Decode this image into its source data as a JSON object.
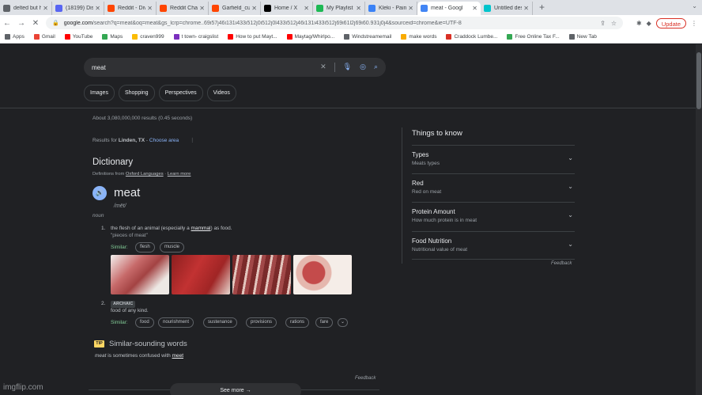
{
  "browser": {
    "tabs": [
      {
        "title": "delted but ha",
        "color": "#5f6368"
      },
      {
        "title": "(18199) Disco",
        "color": "#5865f2"
      },
      {
        "title": "Reddit - Dive",
        "color": "#ff4500"
      },
      {
        "title": "Reddit Chat",
        "color": "#ff4500"
      },
      {
        "title": "Garfield_cult",
        "color": "#ff4500"
      },
      {
        "title": "Home / X",
        "color": "#000000"
      },
      {
        "title": "My Playlist #",
        "color": "#1db954"
      },
      {
        "title": "Kleki - Paint T",
        "color": "#3b82f6"
      },
      {
        "title": "meat - Googl",
        "color": "#4285f4"
      },
      {
        "title": "Untitled desi",
        "color": "#00c4cc"
      }
    ],
    "new_tab": "+",
    "address": {
      "domain": "google.com",
      "path": "/search?q=meat&oq=meat&gs_lcrp=chrome..69i57j46i131i433i512j0i512j0l433i512j46i131i433i512j69i61l2j69i60.931j0j4&sourceid=chrome&ie=UTF-8"
    },
    "update_label": "Update",
    "bookmarks": [
      {
        "label": "Apps",
        "color": "#5f6368"
      },
      {
        "label": "Gmail",
        "color": "#ea4335"
      },
      {
        "label": "YouTube",
        "color": "#ff0000"
      },
      {
        "label": "Maps",
        "color": "#34a853"
      },
      {
        "label": "craven999",
        "color": "#fbbc04"
      },
      {
        "label": "t town- craigslist",
        "color": "#7b2fbe"
      },
      {
        "label": "How to put Mayt...",
        "color": "#ff0000"
      },
      {
        "label": "Maytag/Whirlpo...",
        "color": "#ff0000"
      },
      {
        "label": "Windstreamemail",
        "color": "#5f6368"
      },
      {
        "label": "make words",
        "color": "#f9ab00"
      },
      {
        "label": "Craddock Lumbe...",
        "color": "#d93025"
      },
      {
        "label": "Free Online Tax F...",
        "color": "#34a853"
      },
      {
        "label": "New Tab",
        "color": "#5f6368"
      }
    ]
  },
  "search": {
    "query": "meat",
    "chips": [
      "Images",
      "Shopping",
      "Perspectives",
      "Videos"
    ],
    "stats": "About 3,080,000,000 results (0.45 seconds)",
    "location_prefix": "Results for",
    "location": "Linden, TX",
    "location_sep": " - ",
    "location_link": "Choose area"
  },
  "dictionary": {
    "title": "Dictionary",
    "source_prefix": "Definitions from",
    "source": "Oxford Languages",
    "source_sep": " · ",
    "learn_more": "Learn more",
    "word": "meat",
    "phonetic": "/mēt/",
    "pos": "noun",
    "def1_num": "1.",
    "def1_pre": "the flesh of an animal (especially a",
    "def1_link": "mammal",
    "def1_post": ") as food.",
    "def1_example": "\"pieces of meat\"",
    "similar_label": "Similar:",
    "similar1": [
      "flesh",
      "muscle"
    ],
    "def2_num": "2.",
    "archaic": "ARCHAIC",
    "def2": "food of any kind.",
    "similar2": [
      "food",
      "nourishment",
      "sustenance",
      "provisions",
      "rations",
      "fare"
    ],
    "similar_sounding_title": "Similar-sounding words",
    "tip": "TIP",
    "confused_word": "meat",
    "confused_mid": "is sometimes confused with",
    "confused_with": "meet",
    "feedback": "Feedback",
    "see_more": "See more"
  },
  "things_to_know": {
    "title": "Things to know",
    "items": [
      {
        "title": "Types",
        "subtitle": "Meats types"
      },
      {
        "title": "Red",
        "subtitle": "Red on meat"
      },
      {
        "title": "Protein Amount",
        "subtitle": "How much protein is in meat"
      },
      {
        "title": "Food Nutrition",
        "subtitle": "Nutritional value of meat"
      }
    ],
    "feedback": "Feedback"
  },
  "watermark": "imgflip.com"
}
